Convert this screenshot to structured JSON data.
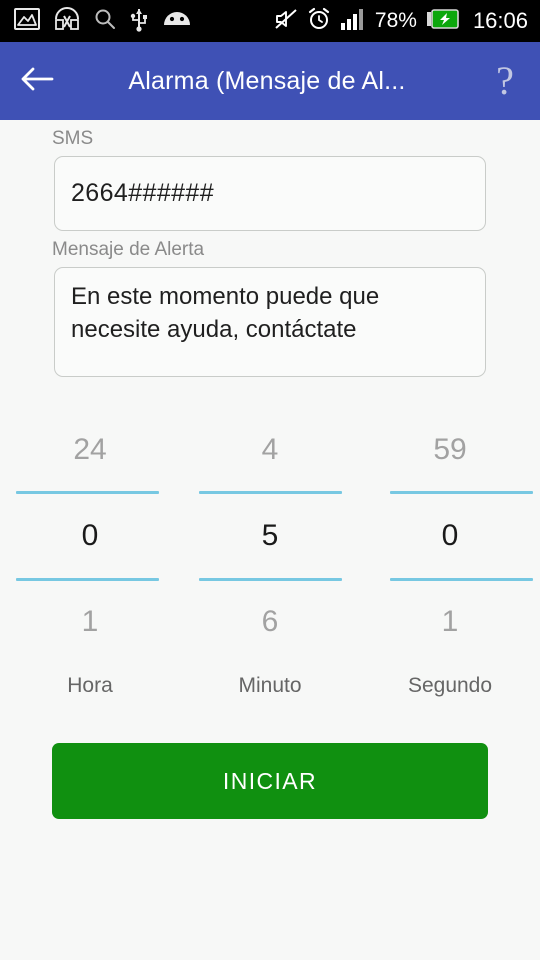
{
  "statusbar": {
    "left_icons": [
      "image-icon",
      "screenshot-transfer-icon",
      "search-icon",
      "usb-icon",
      "android-head-icon"
    ],
    "right_icons": [
      "mute-icon",
      "alarm-clock-icon",
      "signal-bars-icon",
      "battery-charging-icon"
    ],
    "battery_percent": "78%",
    "clock": "16:06"
  },
  "appbar": {
    "back_icon": "arrow-left-icon",
    "title": "Alarma (Mensaje de Al...",
    "help_icon": "question-mark-icon",
    "help_glyph": "?",
    "background_color": "#3F51B5"
  },
  "form": {
    "sms": {
      "label": "SMS",
      "value": "2664######",
      "placeholder": "SMS"
    },
    "message": {
      "label": "Mensaje de Alerta",
      "value": "En este momento puede que necesite ayuda, contáctate",
      "placeholder": "Mensaje de Alerta"
    }
  },
  "pickers": {
    "accent_color": "#77C8E2",
    "columns": [
      {
        "unit": "Hora",
        "above": "24",
        "selected": "0",
        "below": "1"
      },
      {
        "unit": "Minuto",
        "above": "4",
        "selected": "5",
        "below": "6"
      },
      {
        "unit": "Segundo",
        "above": "59",
        "selected": "0",
        "below": "1"
      }
    ]
  },
  "actions": {
    "start_label": "INICIAR",
    "start_color": "#109010"
  }
}
